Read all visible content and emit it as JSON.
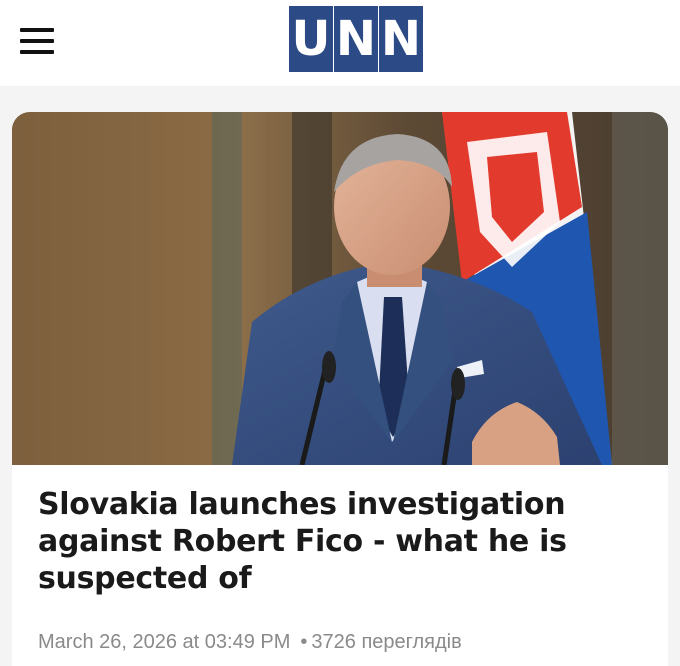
{
  "header": {
    "logo_letters": [
      "U",
      "N",
      "N"
    ],
    "logo_color": "#2b4a86"
  },
  "article": {
    "headline": "Slovakia launches investigation against Robert Fico - what he is suspected of",
    "date": "March 26, 2026 at 03:49 PM",
    "separator": "•",
    "views": "3726 переглядів"
  },
  "colors": {
    "background": "#f4f4f4",
    "card": "#ffffff",
    "headline": "#1a1a1a",
    "meta": "#8a8a8a"
  }
}
